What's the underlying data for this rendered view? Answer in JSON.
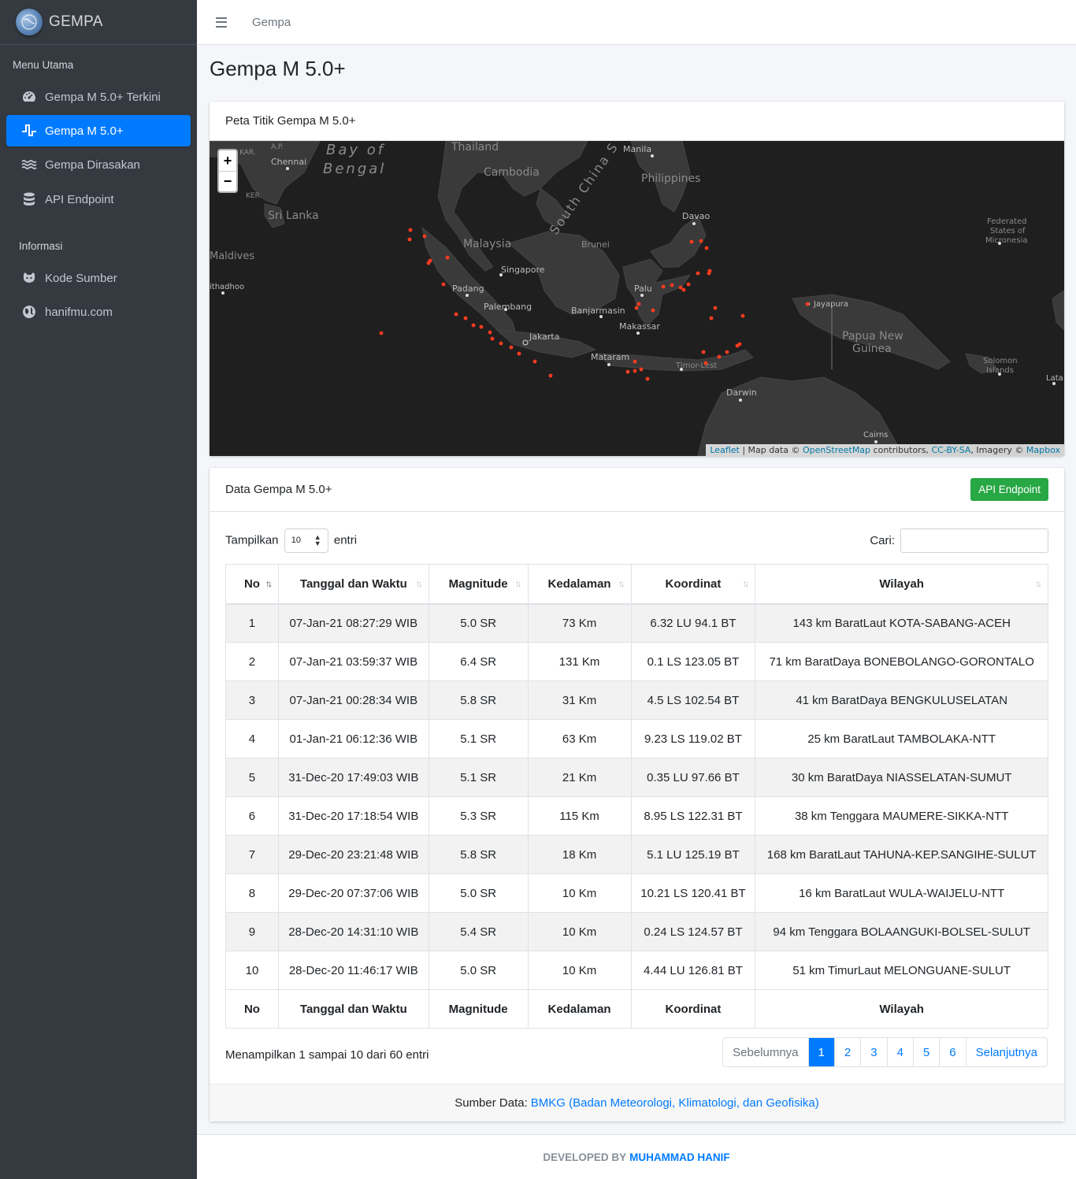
{
  "brand": {
    "name": "GEMPA"
  },
  "sidebar": {
    "header_main": "Menu Utama",
    "items": [
      {
        "label": "Gempa M 5.0+ Terkini",
        "icon": "tachometer-icon"
      },
      {
        "label": "Gempa M 5.0+",
        "icon": "wave-pulse-icon",
        "active": true
      },
      {
        "label": "Gempa Dirasakan",
        "icon": "water-waves-icon"
      },
      {
        "label": "API Endpoint",
        "icon": "database-icon"
      }
    ],
    "header_info": "Informasi",
    "info_items": [
      {
        "label": "Kode Sumber",
        "icon": "github-icon"
      },
      {
        "label": "hanifmu.com",
        "icon": "globe-icon"
      }
    ]
  },
  "topbar": {
    "link": "Gempa"
  },
  "page": {
    "title": "Gempa M 5.0+"
  },
  "map_card": {
    "title": "Peta Titik Gempa M 5.0+",
    "zoom_in": "+",
    "zoom_out": "−",
    "attribution": {
      "leaflet": "Leaflet",
      "sep1": " | Map data © ",
      "osm": "OpenStreetMap",
      "sep2": " contributors, ",
      "license": "CC-BY-SA",
      "sep3": ", Imagery © ",
      "mapbox": "Mapbox"
    },
    "labels": [
      "Bay of",
      "Bengal",
      "Thailand",
      "Cambodia",
      "South China S",
      "Manila",
      "Philippines",
      "Chennai",
      "Sri Lanka",
      "Maldives",
      "Malaysia",
      "Brunei",
      "Davao",
      "Singapore",
      "Padang",
      "Palembang",
      "Banjarmasin",
      "Palu",
      "Makassar",
      "Jakarta",
      "Mataram",
      "Timor-Lest",
      "Jayapura",
      "Papua New",
      "Guinea",
      "Darwin",
      "Federated",
      "States of",
      "Micronesia",
      "Solomon",
      "Islands",
      "Cairns",
      "Lata",
      "ithadhoo",
      "KAR.",
      "A.P.",
      "KER."
    ],
    "marker_color": "#ff3b1f"
  },
  "data_card": {
    "title": "Data Gempa M 5.0+",
    "api_button": "API Endpoint",
    "show_label": "Tampilkan",
    "show_value": "10",
    "entries_label": "entri",
    "search_label": "Cari:",
    "columns": [
      "No",
      "Tanggal dan Waktu",
      "Magnitude",
      "Kedalaman",
      "Koordinat",
      "Wilayah"
    ],
    "rows": [
      [
        "1",
        "07-Jan-21 08:27:29 WIB",
        "5.0 SR",
        "73 Km",
        "6.32 LU 94.1 BT",
        "143 km BaratLaut KOTA-SABANG-ACEH"
      ],
      [
        "2",
        "07-Jan-21 03:59:37 WIB",
        "6.4 SR",
        "131 Km",
        "0.1 LS 123.05 BT",
        "71 km BaratDaya BONEBOLANGO-GORONTALO"
      ],
      [
        "3",
        "07-Jan-21 00:28:34 WIB",
        "5.8 SR",
        "31 Km",
        "4.5 LS 102.54 BT",
        "41 km BaratDaya BENGKULUSELATAN"
      ],
      [
        "4",
        "01-Jan-21 06:12:36 WIB",
        "5.1 SR",
        "63 Km",
        "9.23 LS 119.02 BT",
        "25 km BaratLaut TAMBOLAKA-NTT"
      ],
      [
        "5",
        "31-Dec-20 17:49:03 WIB",
        "5.1 SR",
        "21 Km",
        "0.35 LU 97.66 BT",
        "30 km BaratDaya NIASSELATAN-SUMUT"
      ],
      [
        "6",
        "31-Dec-20 17:18:54 WIB",
        "5.3 SR",
        "115 Km",
        "8.95 LS 122.31 BT",
        "38 km Tenggara MAUMERE-SIKKA-NTT"
      ],
      [
        "7",
        "29-Dec-20 23:21:48 WIB",
        "5.8 SR",
        "18 Km",
        "5.1 LU 125.19 BT",
        "168 km BaratLaut TAHUNA-KEP.SANGIHE-SULUT"
      ],
      [
        "8",
        "29-Dec-20 07:37:06 WIB",
        "5.0 SR",
        "10 Km",
        "10.21 LS 120.41 BT",
        "16 km BaratLaut WULA-WAIJELU-NTT"
      ],
      [
        "9",
        "28-Dec-20 14:31:10 WIB",
        "5.4 SR",
        "10 Km",
        "0.24 LS 124.57 BT",
        "94 km Tenggara BOLAANGUKI-BOLSEL-SULUT"
      ],
      [
        "10",
        "28-Dec-20 11:46:17 WIB",
        "5.0 SR",
        "10 Km",
        "4.44 LU 126.81 BT",
        "51 km TimurLaut MELONGUANE-SULUT"
      ]
    ],
    "info": "Menampilkan 1 sampai 10 dari 60 entri",
    "pagination": [
      "Sebelumnya",
      "1",
      "2",
      "3",
      "4",
      "5",
      "6",
      "Selanjutnya"
    ],
    "current_page": "1",
    "source_label": "Sumber Data:",
    "source_link": "BMKG (Badan Meteorologi, Klimatologi, dan Geofisika)"
  },
  "footer": {
    "prefix": "DEVELOPED BY",
    "author": "MUHAMMAD HANIF"
  }
}
